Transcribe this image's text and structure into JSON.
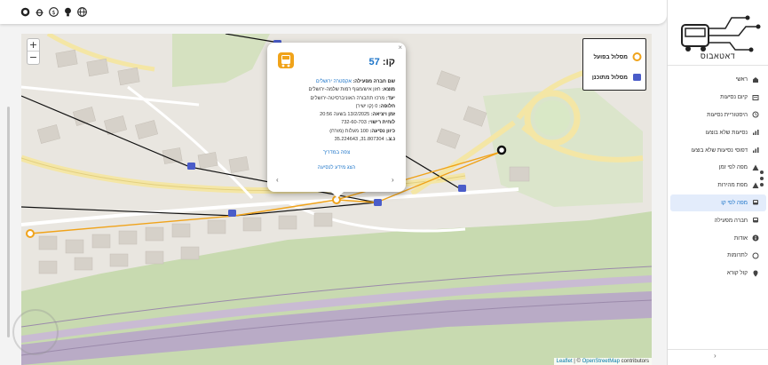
{
  "topbar": {
    "icons": [
      "github-icon",
      "bug-icon",
      "dollar-icon",
      "lightbulb-icon",
      "globe-icon"
    ]
  },
  "map": {
    "zoom_in": "+",
    "zoom_out": "−",
    "attribution_prefix": "Leaflet",
    "attribution_sep": " | © ",
    "attribution_osm": "OpenStreetMap",
    "attribution_suffix": " contributors",
    "legend": {
      "actual": "מסלול בפועל",
      "planned": "מסלול מתוכנן"
    },
    "colors": {
      "actual": "#f0a31a",
      "planned": "#111111",
      "stop": "#4a5cc9",
      "park": "#c8dab0",
      "rail": "#b9abc6"
    }
  },
  "popup": {
    "close": "×",
    "line_label": "קו:",
    "line_number": "57",
    "rows": [
      {
        "label": "שם חברה מפעילה:",
        "value": "אקסטרה ירושלים",
        "link": true
      },
      {
        "label": "מוצא:",
        "value": "חזון איש/מגוף רמות שלמה-ירושלים",
        "link": false
      },
      {
        "label": "יעד:",
        "value": "מרכז תחבורה האוניברסיטה-ירושלים",
        "link": false
      },
      {
        "label": "חלופה:",
        "value": "0 (קו ישיר)",
        "link": false
      },
      {
        "label": "זמן ויציאה:",
        "value": "13/2/2025 בשעה 20:56",
        "link": false
      },
      {
        "label": "לוחית רישוי:",
        "value": "732-60-703",
        "link": false
      },
      {
        "label": "כיוון נסיעה:",
        "value": "100 מעלות (מזרח)",
        "link": false
      },
      {
        "label": "נ.צ.:",
        "value": "31.807304, 35.224643",
        "link": false
      }
    ],
    "guide_link": "צפה במדריך",
    "full_info_link": "הצג מידע לנסיעה",
    "prev": "‹",
    "next": "›"
  },
  "sidebar": {
    "logo_text": "דאטאבוס",
    "items": [
      {
        "label": "ראשי",
        "icon": "home-icon",
        "active": false
      },
      {
        "label": "קיום נסיעות",
        "icon": "list-icon",
        "active": false
      },
      {
        "label": "היסטוריית נסיעות",
        "icon": "history-icon",
        "active": false
      },
      {
        "label": "נסיעות שלא בוצעו",
        "icon": "chart-icon",
        "active": false
      },
      {
        "label": "דפוסי נסיעות שלא בוצעו",
        "icon": "chart-icon",
        "active": false
      },
      {
        "label": "מפה לפי זמן",
        "icon": "warning-icon",
        "active": false
      },
      {
        "label": "מפת מהירות",
        "icon": "warning-icon",
        "active": false
      },
      {
        "label": "מפה לפי קו",
        "icon": "bus-icon",
        "active": true
      },
      {
        "label": "חברה מפעילה",
        "icon": "bus-icon",
        "active": false
      },
      {
        "label": "אודות",
        "icon": "info-icon",
        "active": false
      },
      {
        "label": "לתרומות",
        "icon": "donate-icon",
        "active": false
      },
      {
        "label": "קול קורא",
        "icon": "pin-icon",
        "active": false
      }
    ],
    "collapse": "›"
  }
}
